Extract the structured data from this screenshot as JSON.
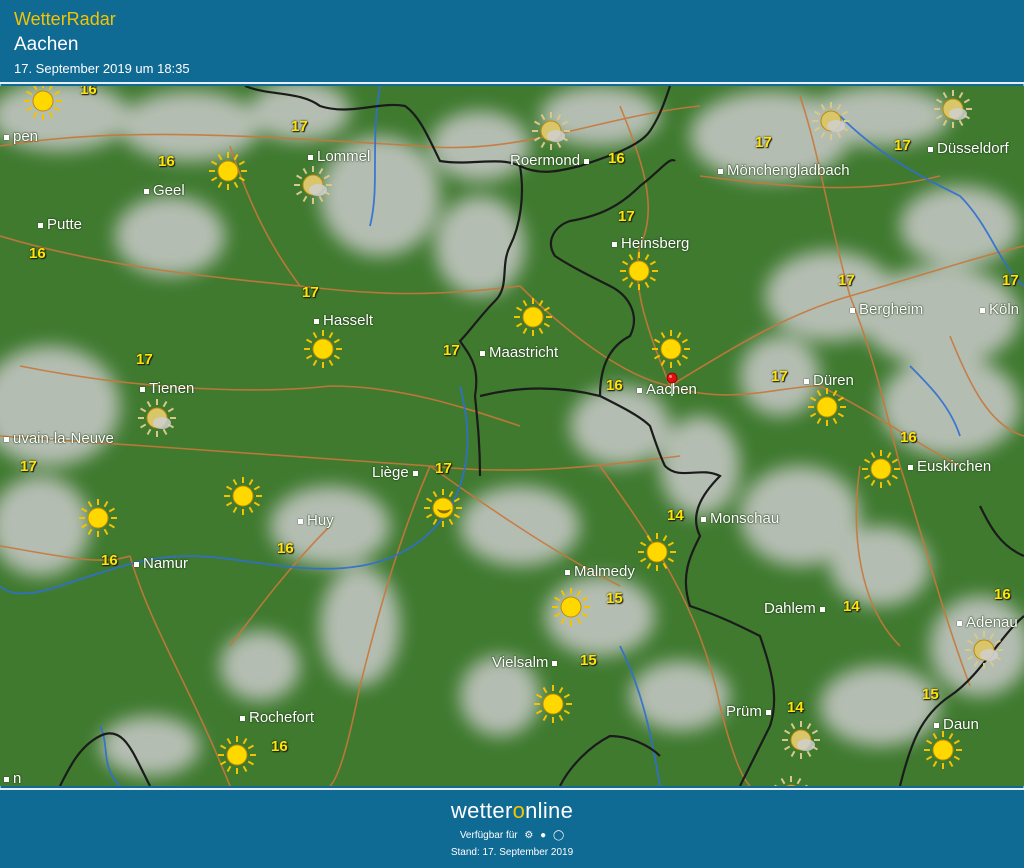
{
  "header": {
    "app_title": "WetterRadar",
    "location": "Aachen",
    "timestamp": "17. September 2019 um 18:35"
  },
  "footer": {
    "brand_pre": "wetter",
    "brand_o": "o",
    "brand_post": "nline",
    "available_label": "Verfügbar für",
    "platform_icons": [
      "android-icon",
      "apple-icon",
      "web-icon"
    ],
    "as_of": "Stand: 17. September 2019"
  },
  "colors": {
    "header_bg": "#0f6a94",
    "title_accent": "#f5c400",
    "map_green": "#3f7a2f",
    "cloud": "#c9c9c9",
    "border_line": "#1b1b1b",
    "road": "#c8783a",
    "river": "#2f6fd1",
    "temperature_text": "#ffe600",
    "location_pin": "#e01010"
  },
  "map": {
    "places": [
      "pen",
      "Lommel",
      "Geel",
      "Putte",
      "Hasselt",
      "Tienen",
      "uvain-la-Neuve",
      "Maastricht",
      "Roermond",
      "Heinsberg",
      "Mönchengladbach",
      "Düsseldorf",
      "Bergheim",
      "Köln",
      "Düren",
      "Aachen",
      "Euskirchen",
      "Liège",
      "Huy",
      "Namur",
      "Monschau",
      "Malmedy",
      "Dahlem",
      "Adenau",
      "Vielsalm",
      "Prüm",
      "Daun",
      "Rochefort",
      "n"
    ],
    "temps": [
      "16",
      "17",
      "16",
      "16",
      "17",
      "17",
      "17",
      "17",
      "16",
      "17",
      "17",
      "17",
      "17",
      "17",
      "17",
      "16",
      "16",
      "17",
      "16",
      "16",
      "14",
      "15",
      "14",
      "16",
      "15",
      "14",
      "15",
      "16"
    ],
    "weather_icons": [
      "sunny-icon",
      "partly-cloudy-icon",
      "night-icon"
    ]
  }
}
